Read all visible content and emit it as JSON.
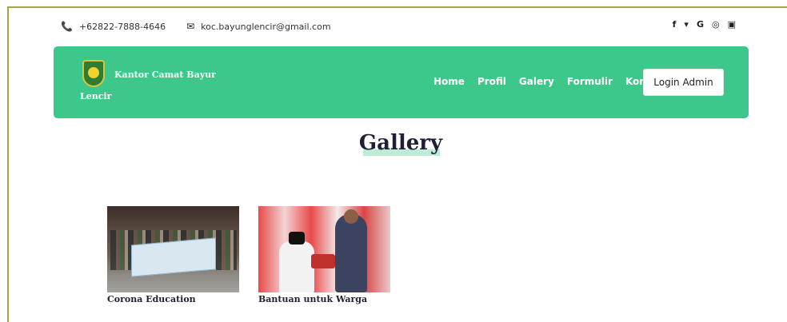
{
  "topbar": {
    "phone": "+62822-7888-4646",
    "email": "koc.bayunglencir@gmail.com",
    "social_icons": [
      "facebook-icon",
      "twitter-icon",
      "google-icon",
      "instagram-icon",
      "youtube-icon"
    ],
    "social_glyphs": [
      "f",
      "🐦",
      "G",
      "◎",
      "▣"
    ]
  },
  "navbar": {
    "brand_line1": "Kantor Camat Bayur",
    "brand_line2": "Lencir",
    "menu": [
      "Home",
      "Profil",
      "Galery",
      "Formulir",
      "Kontak"
    ],
    "login_label": "Login Admin",
    "color": "#3ec78b"
  },
  "gallery": {
    "title": "Gallery",
    "items": [
      {
        "caption": "Corona Education"
      },
      {
        "caption": "Bantuan untuk Warga"
      }
    ]
  }
}
